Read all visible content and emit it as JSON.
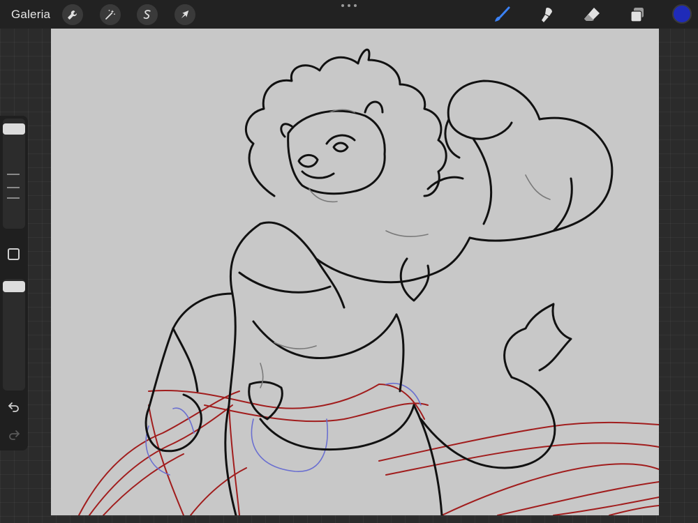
{
  "toolbar": {
    "gallery_label": "Galeria",
    "left_tools": [
      {
        "name": "actions",
        "icon": "wrench-icon"
      },
      {
        "name": "adjustments",
        "icon": "magic-wand-icon"
      },
      {
        "name": "selection",
        "icon": "selection-s-icon"
      },
      {
        "name": "transform",
        "icon": "arrow-cursor-icon"
      }
    ],
    "right_tools": [
      {
        "name": "brush",
        "icon": "brush-icon",
        "active": true
      },
      {
        "name": "smudge",
        "icon": "smudge-icon",
        "active": false
      },
      {
        "name": "eraser",
        "icon": "eraser-icon",
        "active": false
      },
      {
        "name": "layers",
        "icon": "layers-icon",
        "active": false
      }
    ],
    "current_color": "#1f2bb8",
    "active_tool_color": "#3b82f6"
  },
  "sidebar": {
    "brush_size_level": 0.95,
    "opacity_level": 0.98
  },
  "canvas": {
    "background": "#c8c8c8",
    "line_color": "#111111",
    "sketch_red": "#a11d1d",
    "sketch_blue": "#6a6fd0"
  }
}
